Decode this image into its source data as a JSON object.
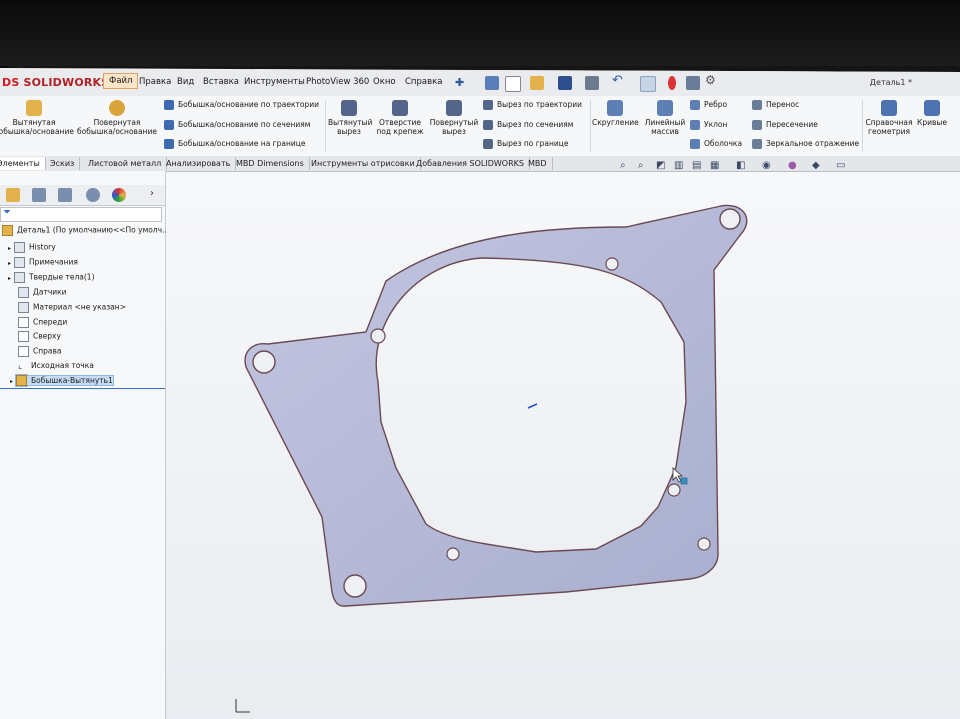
{
  "app": {
    "logo_ds": "DS",
    "logo_name": "SOLIDWORKS",
    "doc_title": "Деталь1 *"
  },
  "menu": [
    "Файл",
    "Правка",
    "Вид",
    "Вставка",
    "Инструменты",
    "PhotoView 360",
    "Окно",
    "Справка"
  ],
  "ribbon": {
    "extruded_boss": "Вытянутая бобышка/основание",
    "revolved_boss": "Повернутая бобышка/основание",
    "swept_boss": "Бобышка/основание по траектории",
    "lofted_boss": "Бобышка/основание по сечениям",
    "boundary_boss": "Бобышка/основание на границе",
    "extruded_cut": "Вытянутый вырез",
    "hole_wizard": "Отверстие под крепеж",
    "revolved_cut": "Повернутый вырез",
    "swept_cut": "Вырез по траектории",
    "lofted_cut": "Вырез по сечениям",
    "boundary_cut": "Вырез по границе",
    "fillet": "Скругление",
    "linear_pattern": "Линейный массив",
    "rib": "Ребро",
    "draft": "Уклон",
    "shell": "Оболочка",
    "wrap": "Перенос",
    "intersect": "Пересечение",
    "mirror": "Зеркальное отражение",
    "ref_geometry": "Справочная геометрия",
    "curves": "Кривые"
  },
  "tabs": [
    "Элементы",
    "Эскиз",
    "Листовой металл",
    "Анализировать",
    "MBD Dimensions",
    "Инструменты отрисовки",
    "Добавления SOLIDWORKS",
    "MBD"
  ],
  "tree": {
    "root": "Деталь1 (По умолчанию<<По умолч...",
    "items": [
      "History",
      "Примечания",
      "Твердые тела(1)",
      "Датчики",
      "Материал <не указан>",
      "Спереди",
      "Сверху",
      "Справа",
      "Исходная точка",
      "Бобышка-Вытянуть1"
    ]
  },
  "colors": {
    "accent": "#d4191f",
    "part_fill": "#b5b9d6",
    "part_edge": "#6a4a52",
    "selection": "#c6dcf5"
  }
}
